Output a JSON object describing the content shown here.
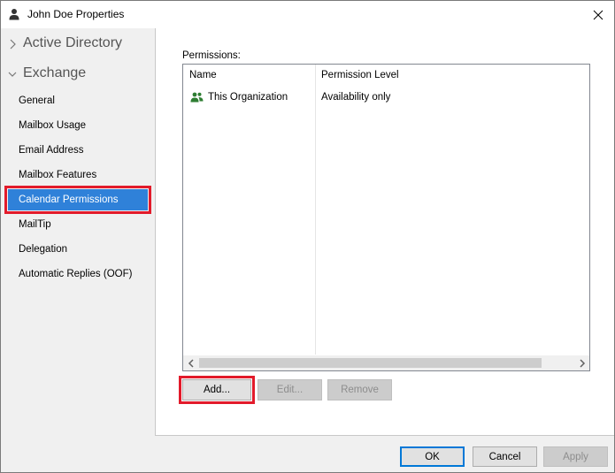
{
  "window": {
    "title": "John Doe Properties",
    "title_icon": "user-icon",
    "close_icon": "close-icon"
  },
  "sidebar": {
    "groups": [
      {
        "label": "Active Directory",
        "icon": "chevron-right-icon",
        "expanded": false
      },
      {
        "label": "Exchange",
        "icon": "chevron-down-icon",
        "expanded": true
      }
    ],
    "items": [
      {
        "label": "General"
      },
      {
        "label": "Mailbox Usage"
      },
      {
        "label": "Email Address"
      },
      {
        "label": "Mailbox Features"
      },
      {
        "label": "Calendar Permissions",
        "selected": true
      },
      {
        "label": "MailTip"
      },
      {
        "label": "Delegation"
      },
      {
        "label": "Automatic Replies (OOF)"
      }
    ]
  },
  "permissions": {
    "label": "Permissions:",
    "columns": [
      "Name",
      "Permission Level"
    ],
    "rows": [
      {
        "name": "This Organization",
        "icon": "group-icon",
        "level": "Availability only"
      }
    ]
  },
  "actions": {
    "add": "Add...",
    "edit": "Edit...",
    "remove": "Remove"
  },
  "footer": {
    "ok": "OK",
    "cancel": "Cancel",
    "apply": "Apply"
  },
  "colors": {
    "selection": "#2f81d9",
    "highlight": "#e21b2b",
    "focus": "#0078d7",
    "group_icon": "#2e7d32"
  }
}
